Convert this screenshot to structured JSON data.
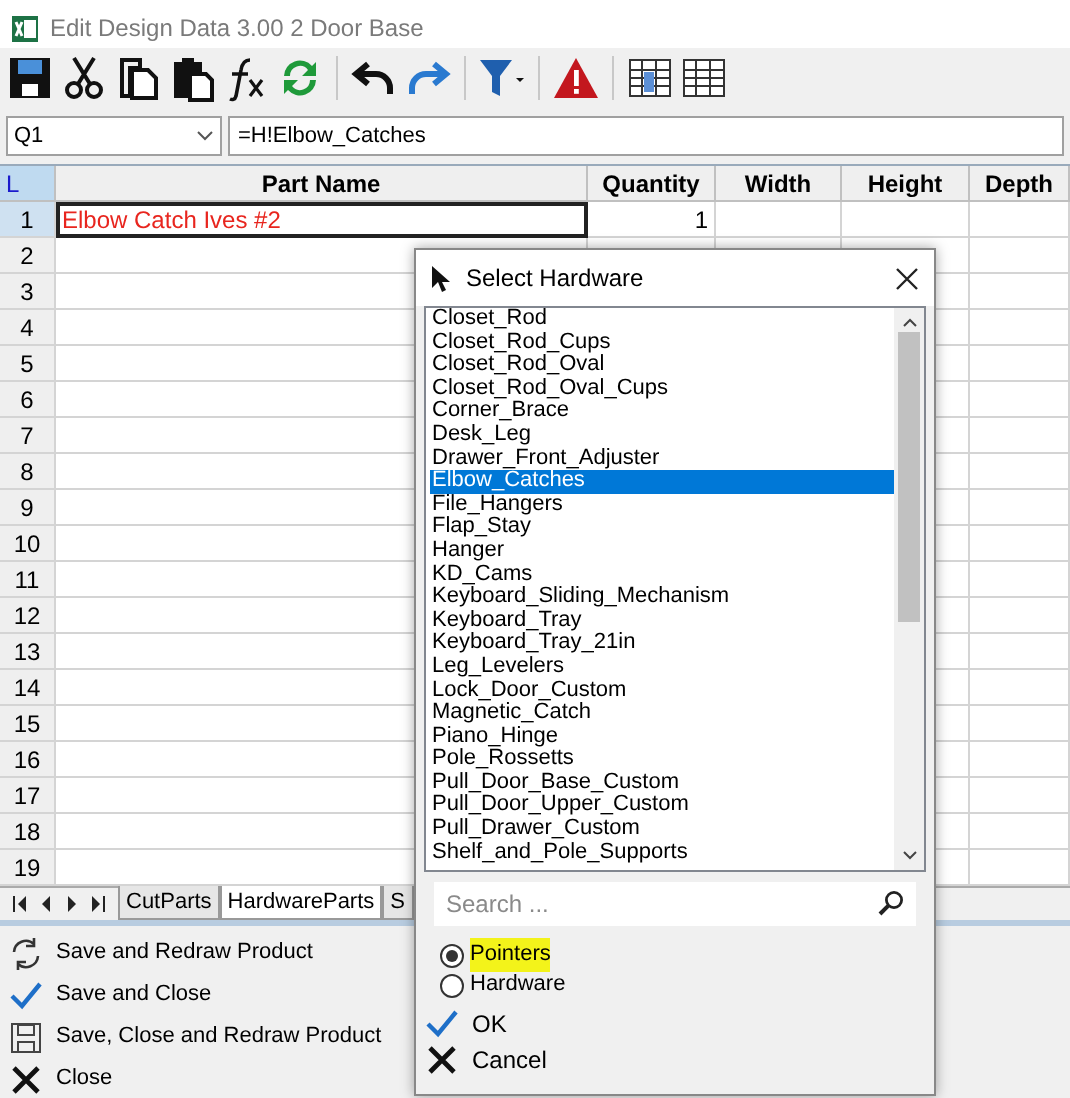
{
  "window": {
    "title": "Edit Design Data 3.00 2 Door Base"
  },
  "formula_bar": {
    "cell_ref": "Q1",
    "formula": "=H!Elbow_Catches"
  },
  "sheet": {
    "corner": "L",
    "columns": [
      "Part Name",
      "Quantity",
      "Width",
      "Height",
      "Depth"
    ],
    "rows": [
      {
        "number": "1",
        "selected": true,
        "part_name": "Elbow Catch Ives #2",
        "quantity": "1"
      },
      {
        "number": "2",
        "selected": false
      },
      {
        "number": "3",
        "selected": false
      },
      {
        "number": "4",
        "selected": false
      },
      {
        "number": "5",
        "selected": false
      },
      {
        "number": "6",
        "selected": false
      },
      {
        "number": "7",
        "selected": false
      },
      {
        "number": "8",
        "selected": false
      },
      {
        "number": "9",
        "selected": false
      },
      {
        "number": "10",
        "selected": false
      },
      {
        "number": "11",
        "selected": false
      },
      {
        "number": "12",
        "selected": false
      },
      {
        "number": "13",
        "selected": false
      },
      {
        "number": "14",
        "selected": false
      },
      {
        "number": "15",
        "selected": false
      },
      {
        "number": "16",
        "selected": false
      },
      {
        "number": "17",
        "selected": false
      },
      {
        "number": "18",
        "selected": false
      },
      {
        "number": "19",
        "selected": false
      }
    ]
  },
  "sheet_tabs": [
    {
      "label": "CutParts",
      "selected": false
    },
    {
      "label": "HardwareParts",
      "selected": true
    },
    {
      "label": "S",
      "selected": false
    }
  ],
  "actions": [
    {
      "label": "Save and Redraw Product",
      "kind": "redraw"
    },
    {
      "label": "Save and Close",
      "kind": "check"
    },
    {
      "label": "Save, Close and Redraw Product",
      "kind": "save"
    },
    {
      "label": "Close",
      "kind": "close"
    }
  ],
  "dialog": {
    "title": "Select Hardware",
    "items": [
      {
        "label": "Closet_Rod",
        "selected": false
      },
      {
        "label": "Closet_Rod_Cups",
        "selected": false
      },
      {
        "label": "Closet_Rod_Oval",
        "selected": false
      },
      {
        "label": "Closet_Rod_Oval_Cups",
        "selected": false
      },
      {
        "label": "Corner_Brace",
        "selected": false
      },
      {
        "label": "Desk_Leg",
        "selected": false
      },
      {
        "label": "Drawer_Front_Adjuster",
        "selected": false
      },
      {
        "label": "Elbow_Catches",
        "selected": true
      },
      {
        "label": "File_Hangers",
        "selected": false
      },
      {
        "label": "Flap_Stay",
        "selected": false
      },
      {
        "label": "Hanger",
        "selected": false
      },
      {
        "label": "KD_Cams",
        "selected": false
      },
      {
        "label": "Keyboard_Sliding_Mechanism",
        "selected": false
      },
      {
        "label": "Keyboard_Tray",
        "selected": false
      },
      {
        "label": "Keyboard_Tray_21in",
        "selected": false
      },
      {
        "label": "Leg_Levelers",
        "selected": false
      },
      {
        "label": "Lock_Door_Custom",
        "selected": false
      },
      {
        "label": "Magnetic_Catch",
        "selected": false
      },
      {
        "label": "Piano_Hinge",
        "selected": false
      },
      {
        "label": "Pole_Rossetts",
        "selected": false
      },
      {
        "label": "Pull_Door_Base_Custom",
        "selected": false
      },
      {
        "label": "Pull_Door_Upper_Custom",
        "selected": false
      },
      {
        "label": "Pull_Drawer_Custom",
        "selected": false
      },
      {
        "label": "Shelf_and_Pole_Supports",
        "selected": false
      }
    ],
    "search": {
      "placeholder": "Search ..."
    },
    "options": [
      {
        "label": "Pointers",
        "selected": true,
        "highlighted": true
      },
      {
        "label": "Hardware",
        "selected": false,
        "highlighted": false
      }
    ],
    "buttons": [
      {
        "label": "OK",
        "kind": "ok"
      },
      {
        "label": "Cancel",
        "kind": "cancel"
      }
    ]
  }
}
